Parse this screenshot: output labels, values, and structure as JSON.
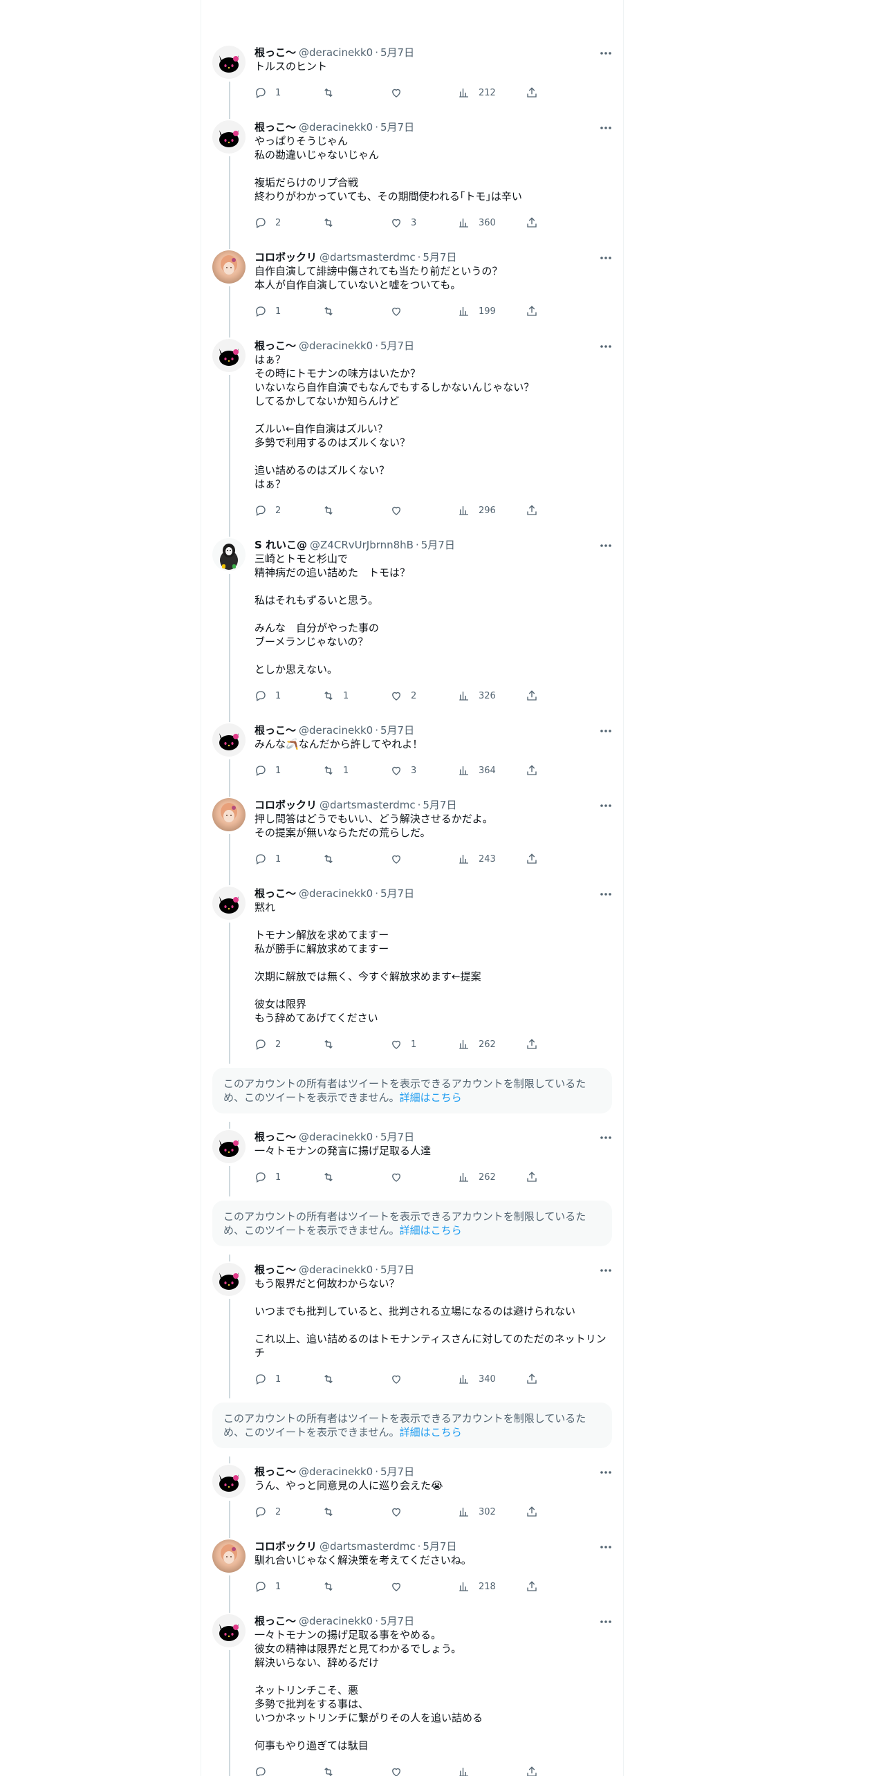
{
  "tweets": [
    {
      "name": "根っこ～",
      "handle": "@deracinekk0",
      "date": "5月7日",
      "text": "トルスのヒント",
      "reply": "1",
      "retweet": "",
      "like": "",
      "views": "212",
      "avatar": "kitty"
    },
    {
      "name": "根っこ～",
      "handle": "@deracinekk0",
      "date": "5月7日",
      "text": "やっぱりそうじゃん\n私の勘違いじゃないじゃん\n\n複垢だらけのリプ合戦\n終わりがわかっていても、その期間使われる｢トモ｣は辛い",
      "reply": "2",
      "retweet": "",
      "like": "3",
      "views": "360",
      "avatar": "kitty"
    },
    {
      "name": "コロボックリ",
      "handle": "@dartsmasterdmc",
      "date": "5月7日",
      "text": "自作自演して誹謗中傷されても当たり前だというの？\n本人が自作自演していないと嘘をついても。",
      "reply": "1",
      "retweet": "",
      "like": "",
      "views": "199",
      "avatar": "girl"
    },
    {
      "name": "根っこ～",
      "handle": "@deracinekk0",
      "date": "5月7日",
      "text": "はぁ？\nその時にトモナンの味方はいたか？\nいないなら自作自演でもなんでもするしかないんじゃない？\nしてるかしてないか知らんけど\n\nズルい←自作自演はズルい？\n多勢で利用するのはズルくない？\n\n追い詰めるのはズルくない？\nはぁ？",
      "reply": "2",
      "retweet": "",
      "like": "",
      "views": "296",
      "avatar": "kitty"
    },
    {
      "name": "S れいこ@",
      "handle": "@Z4CRvUrJbrnn8hB",
      "date": "5月7日",
      "text": "三崎とトモと杉山で\n精神病だの追い詰めた　トモは？\n\n私はそれもずるいと思う。\n\nみんな　自分がやった事の\nブーメランじゃないの？\n\nとしか思えない。",
      "reply": "1",
      "retweet": "1",
      "like": "2",
      "views": "326",
      "avatar": "mask"
    },
    {
      "name": "根っこ～",
      "handle": "@deracinekk0",
      "date": "5月7日",
      "text": "みんな🪃なんだから許してやれよ！",
      "reply": "1",
      "retweet": "1",
      "like": "3",
      "views": "364",
      "avatar": "kitty"
    },
    {
      "name": "コロボックリ",
      "handle": "@dartsmasterdmc",
      "date": "5月7日",
      "text": "押し問答はどうでもいい、どう解決させるかだよ。\nその提案が無いならただの荒らしだ。",
      "reply": "1",
      "retweet": "",
      "like": "",
      "views": "243",
      "avatar": "girl"
    },
    {
      "name": "根っこ～",
      "handle": "@deracinekk0",
      "date": "5月7日",
      "text": "黙れ\n\nトモナン解放を求めてますー\n私が勝手に解放求めてますー\n\n次期に解放では無く、今すぐ解放求めます←提案\n\n彼女は限界\nもう辞めてあげてください",
      "reply": "2",
      "retweet": "",
      "like": "1",
      "views": "262",
      "avatar": "kitty"
    },
    {
      "name": "根っこ～",
      "handle": "@deracinekk0",
      "date": "5月7日",
      "text": "一々トモナンの発言に揚げ足取る人達",
      "reply": "1",
      "retweet": "",
      "like": "",
      "views": "262",
      "avatar": "kitty"
    },
    {
      "name": "根っこ～",
      "handle": "@deracinekk0",
      "date": "5月7日",
      "text": "もう限界だと何故わからない？\n\nいつまでも批判していると、批判される立場になるのは避けられない\n\nこれ以上、追い詰めるのはトモナンティスさんに対してのただのネットリンチ",
      "reply": "1",
      "retweet": "",
      "like": "",
      "views": "340",
      "avatar": "kitty"
    },
    {
      "name": "根っこ～",
      "handle": "@deracinekk0",
      "date": "5月7日",
      "text": "うん、やっと同意見の人に巡り会えた😭",
      "reply": "2",
      "retweet": "",
      "like": "",
      "views": "302",
      "avatar": "kitty"
    },
    {
      "name": "コロボックリ",
      "handle": "@dartsmasterdmc",
      "date": "5月7日",
      "text": "馴れ合いじゃなく解決策を考えてくださいね。",
      "reply": "1",
      "retweet": "",
      "like": "",
      "views": "218",
      "avatar": "girl"
    },
    {
      "name": "根っこ～",
      "handle": "@deracinekk0",
      "date": "5月7日",
      "text": "一々トモナンの揚げ足取る事をやめる。\n彼女の精神は限界だと見てわかるでしょう。\n解決いらない、辞めるだけ\n\nネットリンチこそ、悪\n多勢で批判をする事は、\nいつかネットリンチに繋がりその人を追い詰める\n\n何事もやり過ぎては駄目",
      "reply": "",
      "retweet": "",
      "like": "",
      "views": "",
      "avatar": "kitty"
    }
  ],
  "restricted": {
    "text": "このアカウントの所有者はツイートを表示できるアカウントを制限しているため、このツイートを表示できません。",
    "link": "詳細はこちら"
  },
  "icons": {
    "reply": "reply-icon",
    "retweet": "retweet-icon",
    "like": "heart-icon",
    "views": "views-icon",
    "share": "share-icon",
    "more": "more-icon"
  },
  "colors": {
    "secondary": "#536471",
    "link": "#1d9bf0",
    "thread_line": "#cfd9de",
    "restricted_bg": "#f7f9f9"
  }
}
